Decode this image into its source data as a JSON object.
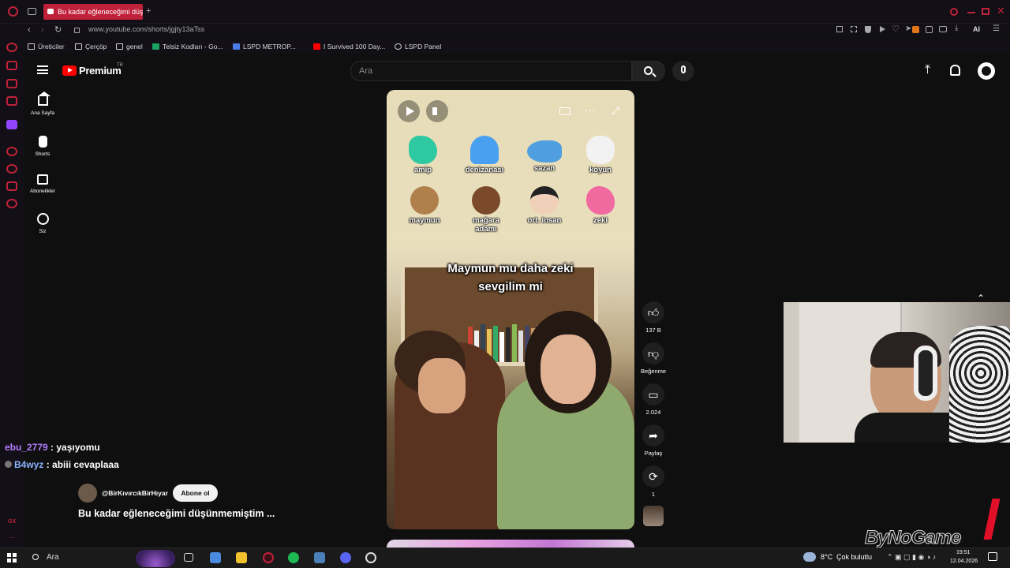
{
  "browser": {
    "tab_title": "Bu kadar eğleneceğimi düş",
    "new_tab": "+",
    "url": "www.youtube.com/shorts/jgjty13aTss",
    "ai_label": "AI",
    "bookmarks": [
      "Üreticiler",
      "Çerçöp",
      "genel",
      "Telsiz Kodları - Go...",
      "LSPD METROP...",
      "I Survived 100 Day...",
      "LSPD Panel"
    ]
  },
  "youtube": {
    "logo_text": "Premium",
    "logo_region": "TR",
    "search_placeholder": "Ara",
    "nav": [
      {
        "label": "Ana Sayfa",
        "icon": "home-icon"
      },
      {
        "label": "Shorts",
        "icon": "shorts-icon"
      },
      {
        "label": "Abonelikler",
        "icon": "subscriptions-icon"
      },
      {
        "label": "Siz",
        "icon": "user-icon"
      }
    ]
  },
  "video": {
    "emojis": [
      {
        "label": "amip",
        "color": "#2ec9a0"
      },
      {
        "label": "denizanası",
        "color": "#4aa0f0"
      },
      {
        "label": "sazan",
        "color": "#4f9ee0"
      },
      {
        "label": "koyun",
        "color": "#f2f2f2"
      },
      {
        "label": "maymun",
        "color": "#b0804c"
      },
      {
        "label": "mağara adamı",
        "color": "#7a4a2a"
      },
      {
        "label": "ort. insan",
        "color": "#f0d0b8"
      },
      {
        "label": "zeki",
        "color": "#f06aa0"
      }
    ],
    "caption_line1": "Maymun mu daha zeki",
    "caption_line2": "sevgilim mi"
  },
  "actions": {
    "like_count": "137 B",
    "dislike_label": "Beğenme",
    "comment_count": "2.024",
    "share_label": "Paylaş",
    "remix_count": "1"
  },
  "channel": {
    "handle": "@BirKıvırcıkBirHıyar",
    "subscribe_label": "Abone ol",
    "video_title": "Bu kadar eğleneceğimi düşünmemiştim ..."
  },
  "chat": [
    {
      "user": "ebu_2779",
      "message": "yaşıyomu",
      "color": "#b57cff"
    },
    {
      "user": "B4wyz",
      "message": "abiii cevaplaaa",
      "color": "#8ab4ff"
    }
  ],
  "watermark": "ByNoGame",
  "taskbar": {
    "search_placeholder": "Ara",
    "weather_temp": "8°C",
    "weather_text": "Çok bulutlu",
    "time": "19:51",
    "date": "12.04.2026",
    "gx_label": "GX"
  }
}
